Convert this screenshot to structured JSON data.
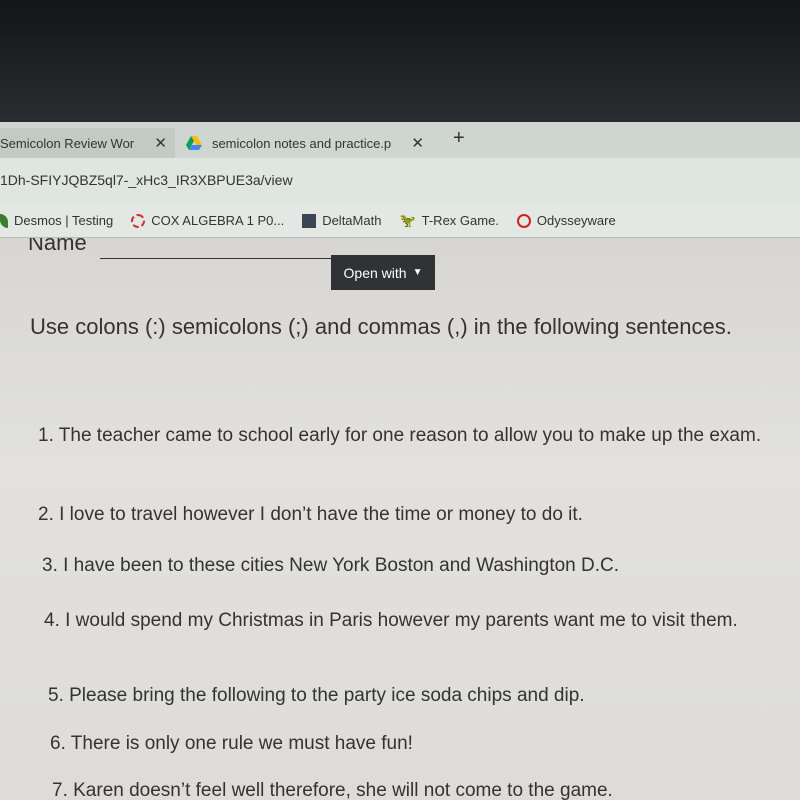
{
  "browser": {
    "tabs": [
      {
        "label": "Semicolon Review Work",
        "active": false
      },
      {
        "label": "semicolon notes and practice.p",
        "active": true,
        "icon": "google-drive-icon"
      }
    ],
    "new_tab": "+",
    "close": "✕",
    "url": "1Dh-SFIYJQBZ5ql7-_xHc3_IR3XBPUE3a/view",
    "bookmarks": [
      {
        "label": "Desmos | Testing",
        "icon": "desmos-icon"
      },
      {
        "label": "COX ALGEBRA 1 P0...",
        "icon": "loading-circle-icon"
      },
      {
        "label": "DeltaMath",
        "icon": "graduation-cap-icon"
      },
      {
        "label": "T-Rex Game.",
        "icon": "dinosaur-icon"
      },
      {
        "label": "Odysseyware",
        "icon": "odysseyware-icon"
      }
    ]
  },
  "viewer": {
    "open_with": "Open with"
  },
  "document": {
    "name_label": "Name",
    "instructions": "Use colons (:) semicolons (;) and commas (,) in the following sentences.",
    "questions": [
      "1. The teacher came to school early for one reason to allow you to make up the exam.",
      "2. I love to travel however I don’t have the time or money to do it.",
      "3. I have been to these cities New York Boston and Washington D.C.",
      "4. I would spend my Christmas in Paris however my parents want me to visit them.",
      "5. Please bring the following to the party ice soda chips and dip.",
      "6. There is only one rule we must have fun!",
      "7. Karen doesn’t feel well therefore, she will not come to the game."
    ]
  }
}
